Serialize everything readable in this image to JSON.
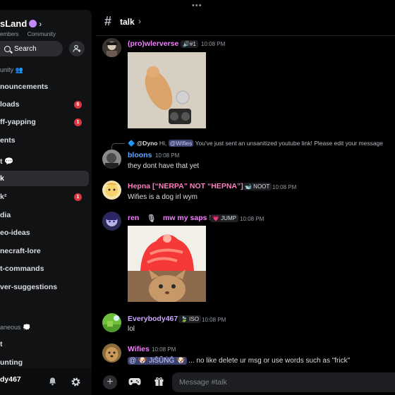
{
  "server": {
    "title": "sLand",
    "members_label": "embers",
    "community_label": "Community",
    "search_label": "Search"
  },
  "sidebar": {
    "categories": [
      {
        "label": "unity 👥"
      },
      {
        "label": "aneous 💭"
      }
    ],
    "channels": [
      {
        "label": "nouncements",
        "badge": ""
      },
      {
        "label": "loads",
        "badge": "6"
      },
      {
        "label": "ff-yapping",
        "badge": "1"
      },
      {
        "label": "ents",
        "badge": ""
      },
      {
        "label": "t 💬",
        "badge": ""
      },
      {
        "label": "k",
        "badge": ""
      },
      {
        "label": "k²",
        "badge": "1"
      },
      {
        "label": "dia",
        "badge": ""
      },
      {
        "label": "eo-ideas",
        "badge": ""
      },
      {
        "label": "necraft-lore",
        "badge": ""
      },
      {
        "label": "t-commands",
        "badge": ""
      },
      {
        "label": "ver-suggestions",
        "badge": ""
      },
      {
        "label": "t",
        "badge": ""
      },
      {
        "label": "unting",
        "badge": ""
      }
    ]
  },
  "user": {
    "name": "dy467"
  },
  "channel": {
    "name": "talk"
  },
  "messages": [
    {
      "author": "(pro)wlerverse",
      "color": "#f47fff",
      "tag": "🔊#1",
      "time": "10:08 PM"
    },
    {
      "reply_author": "@Dyno",
      "reply_text_a": "Hi, ",
      "reply_mention": "@Wifies",
      "reply_text_b": " You've just sent an unsanitized youtube link! Please edit your message"
    },
    {
      "author": "bloons",
      "color": "#5fa8ff",
      "time": "10:08 PM",
      "text": "they dont have that yet"
    },
    {
      "author": "Hepna [“NERPA” NOT “HEPNA”]",
      "color": "#ff7fbf",
      "tag": "🐋 NOOT",
      "time": "10:08 PM",
      "text": "Wifies is a dog irl wym"
    },
    {
      "author_a": "ren",
      "author_b": "mw my saps !",
      "color": "#f47fff",
      "tag": "💗 JUMP",
      "time": "10:08 PM"
    },
    {
      "author": "Everybody467",
      "color": "#c9a6ff",
      "tag": "🍃 ISO",
      "time": "10:08 PM",
      "text": "lol"
    },
    {
      "author": "Wifies",
      "color": "#f47fff",
      "time": "10:08 PM",
      "mention": "@ 🐶 JιŠŨŃĜ 🐶",
      "text": "... no like delete ur msg or use words such as \"frick\""
    }
  ],
  "composer": {
    "placeholder": "Message #talk"
  },
  "colors": {
    "accent": "#5865f2",
    "badge": "#da373c"
  }
}
